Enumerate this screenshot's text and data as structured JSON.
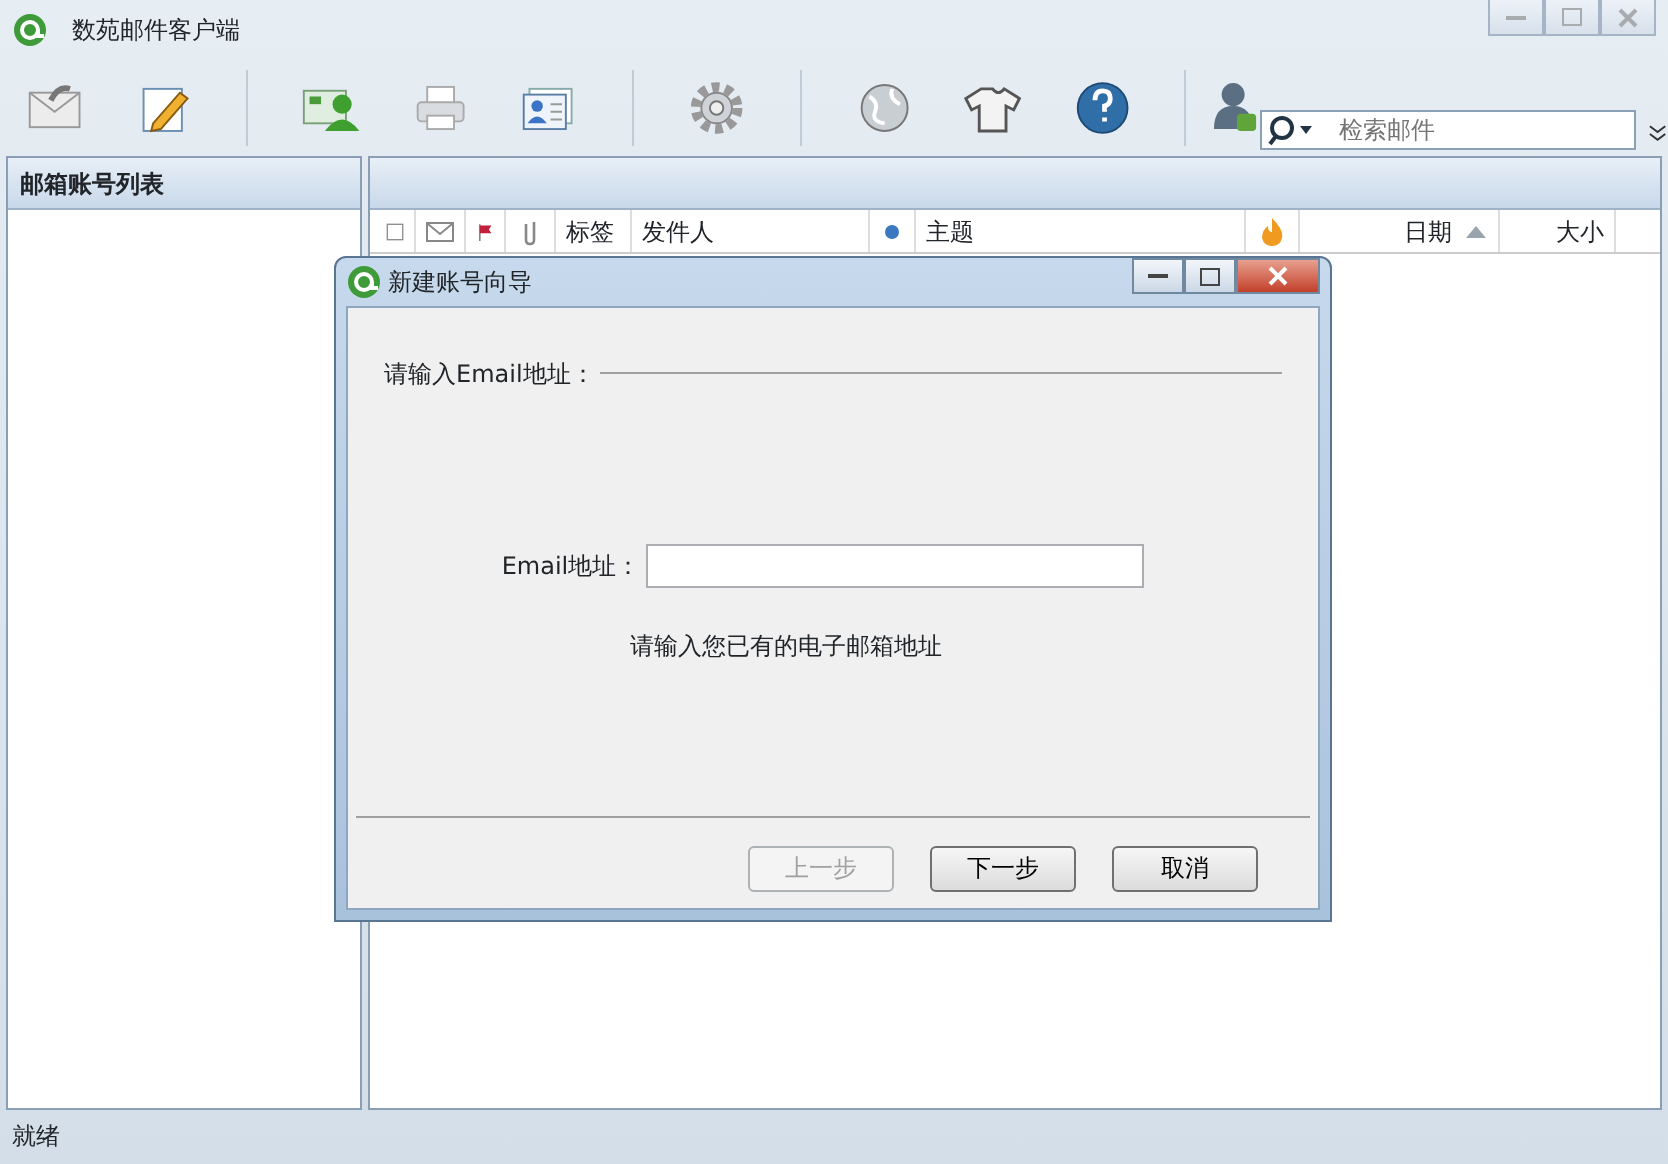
{
  "window": {
    "title": "数苑邮件客户端"
  },
  "search": {
    "placeholder": "检索邮件"
  },
  "sidebar": {
    "title": "邮箱账号列表"
  },
  "mail_list": {
    "select_all_checked": false,
    "columns": [
      {
        "label": "标签",
        "sorted": false
      },
      {
        "label": "发件人",
        "sorted": false
      },
      {
        "label": "主题",
        "sorted": false
      },
      {
        "label": "日期",
        "sorted": true
      },
      {
        "label": "大小",
        "sorted": false
      }
    ]
  },
  "dialog": {
    "title": "新建账号向导",
    "section_label": "请输入Email地址：",
    "field_label": "Email地址：",
    "hint": "请输入您已有的电子邮箱地址",
    "buttons": [
      {
        "label": "上一步",
        "disabled": true
      },
      {
        "label": "下一步",
        "disabled": false
      },
      {
        "label": "取消",
        "disabled": false
      }
    ]
  },
  "status_bar": {
    "text": "就绪"
  }
}
